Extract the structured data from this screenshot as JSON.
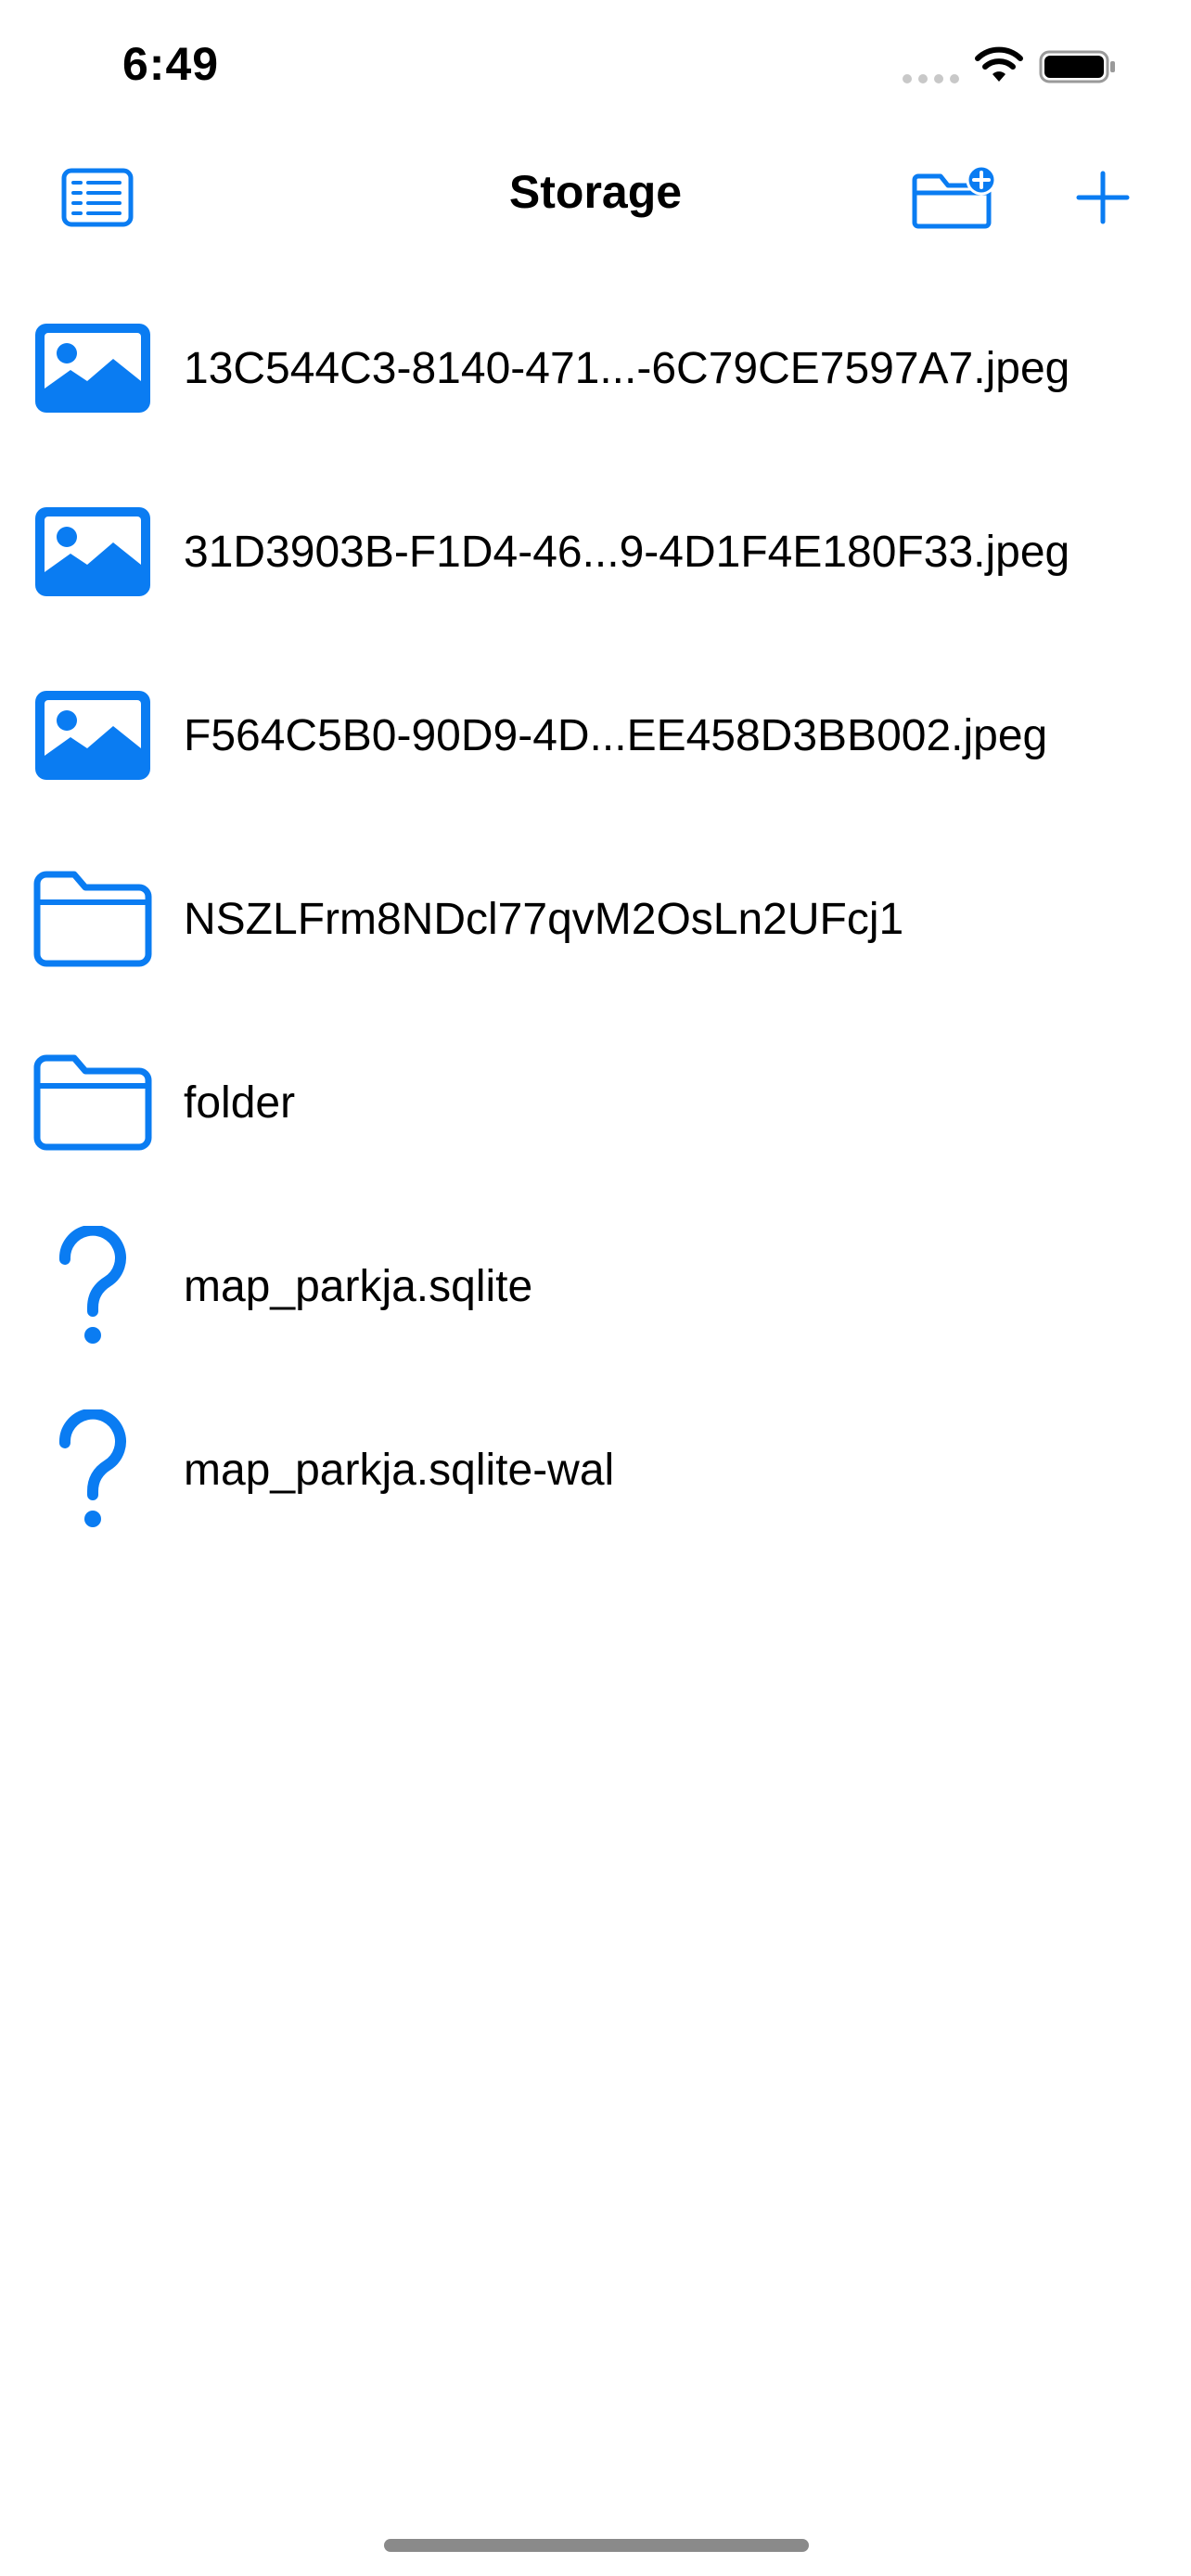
{
  "status_bar": {
    "time": "6:49"
  },
  "nav": {
    "title": "Storage",
    "left_icon": "list-document-icon",
    "right_icons": [
      "folder-add-icon",
      "plus-icon"
    ]
  },
  "files": [
    {
      "name": "13C544C3-8140-471...-6C79CE7597A7.jpeg",
      "icon": "photo-icon"
    },
    {
      "name": "31D3903B-F1D4-46...9-4D1F4E180F33.jpeg",
      "icon": "photo-icon"
    },
    {
      "name": "F564C5B0-90D9-4D...EE458D3BB002.jpeg",
      "icon": "photo-icon"
    },
    {
      "name": "NSZLFrm8NDcl77qvM2OsLn2UFcj1",
      "icon": "folder-icon"
    },
    {
      "name": "folder",
      "icon": "folder-icon"
    },
    {
      "name": "map_parkja.sqlite",
      "icon": "question-icon"
    },
    {
      "name": "map_parkja.sqlite-wal",
      "icon": "question-icon"
    }
  ],
  "colors": {
    "accent": "#0a7cf2",
    "text": "#000000",
    "background": "#ffffff"
  }
}
